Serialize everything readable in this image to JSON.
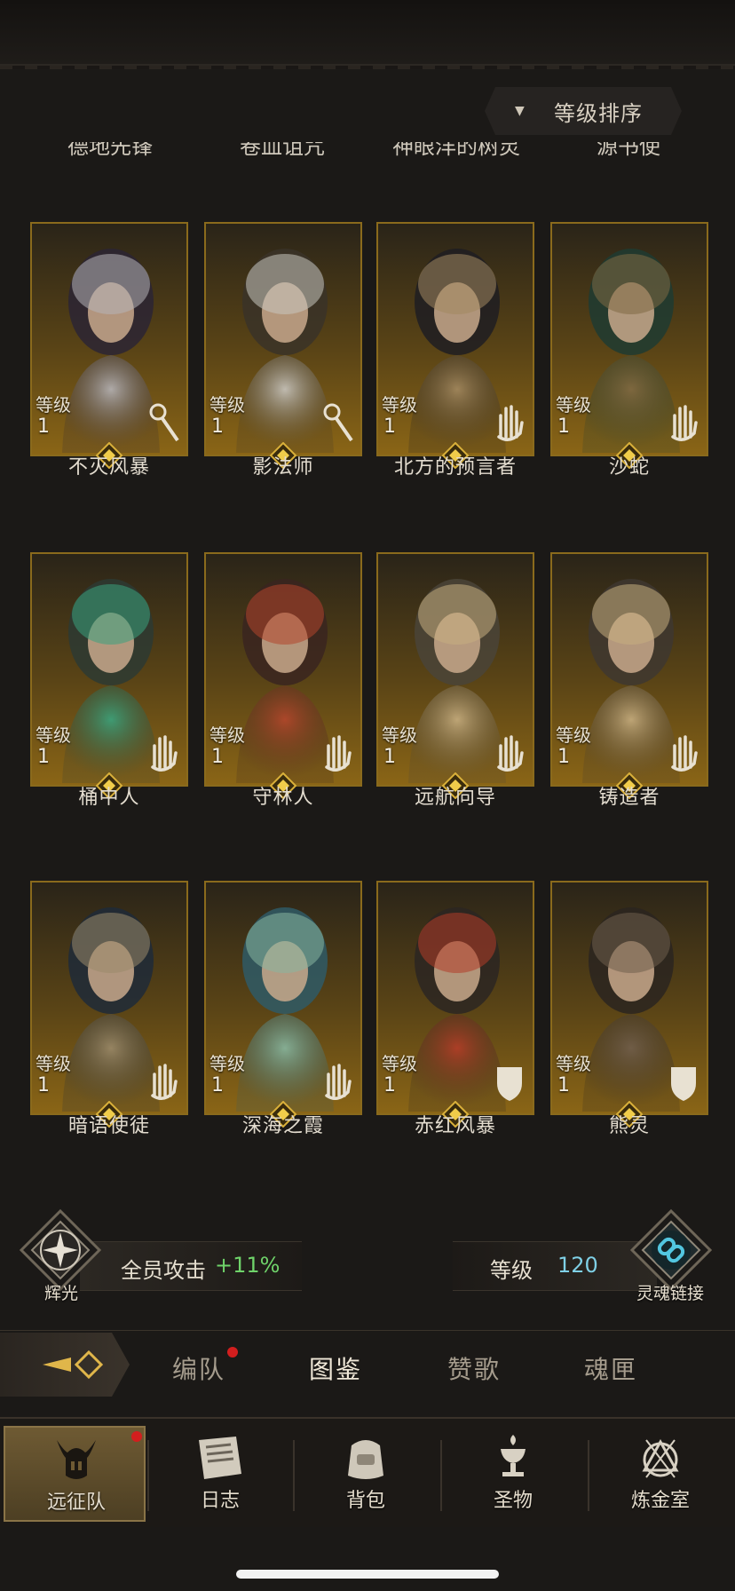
{
  "sort_button": {
    "label": "等级排序"
  },
  "cut_names": [
    "德地先锋",
    "卷血诅咒",
    "神眼洋的树灵",
    "源书使"
  ],
  "heroes": [
    {
      "name": "不灭风暴",
      "level_label": "等级",
      "level": "1",
      "class_icon": "staff-icon",
      "portrait": "witch-hat"
    },
    {
      "name": "影法师",
      "level_label": "等级",
      "level": "1",
      "class_icon": "staff-icon",
      "portrait": "silver-elf"
    },
    {
      "name": "北方的预言者",
      "level_label": "等级",
      "level": "1",
      "class_icon": "hand-icon",
      "portrait": "dark-hair"
    },
    {
      "name": "沙蛇",
      "level_label": "等级",
      "level": "1",
      "class_icon": "hand-icon",
      "portrait": "green-hood"
    },
    {
      "name": "桶中人",
      "level_label": "等级",
      "level": "1",
      "class_icon": "hand-icon",
      "portrait": "barrel"
    },
    {
      "name": "守林人",
      "level_label": "等级",
      "level": "1",
      "class_icon": "hand-icon",
      "portrait": "red-hair"
    },
    {
      "name": "远航向导",
      "level_label": "等级",
      "level": "1",
      "class_icon": "hand-icon",
      "portrait": "blonde"
    },
    {
      "name": "铸造者",
      "level_label": "等级",
      "level": "1",
      "class_icon": "hand-icon",
      "portrait": "braid"
    },
    {
      "name": "暗语使徒",
      "level_label": "等级",
      "level": "1",
      "class_icon": "hand-icon",
      "portrait": "blue-hood"
    },
    {
      "name": "深海之霞",
      "level_label": "等级",
      "level": "1",
      "class_icon": "hand-icon",
      "portrait": "green-curl"
    },
    {
      "name": "赤红风暴",
      "level_label": "等级",
      "level": "1",
      "class_icon": "shield-icon",
      "portrait": "viking"
    },
    {
      "name": "熊灵",
      "level_label": "等级",
      "level": "1",
      "class_icon": "shield-icon",
      "portrait": "bear"
    }
  ],
  "bonus": {
    "left_badge_label": "辉光",
    "team_attack_label": "全员攻击",
    "team_attack_value": "+11%",
    "level_label": "等级",
    "level_value": "120",
    "right_badge_label": "灵魂链接"
  },
  "subtabs": [
    {
      "label": "编队",
      "active": false,
      "dot": true
    },
    {
      "label": "图鉴",
      "active": true,
      "dot": false
    },
    {
      "label": "赞歌",
      "active": false,
      "dot": false
    },
    {
      "label": "魂匣",
      "active": false,
      "dot": false
    }
  ],
  "bottom_nav": [
    {
      "label": "远征队",
      "icon": "helmet-icon",
      "active": true,
      "dot": true
    },
    {
      "label": "日志",
      "icon": "scroll-icon",
      "active": false,
      "dot": false
    },
    {
      "label": "背包",
      "icon": "backpack-icon",
      "active": false,
      "dot": false
    },
    {
      "label": "圣物",
      "icon": "chalice-icon",
      "active": false,
      "dot": false
    },
    {
      "label": "炼金室",
      "icon": "alchemy-icon",
      "active": false,
      "dot": false
    }
  ],
  "colors": {
    "accent_gold": "#c8a040",
    "bonus_green": "#6fd36a",
    "level_blue": "#7fd0e6",
    "notify_red": "#d21e1e"
  }
}
